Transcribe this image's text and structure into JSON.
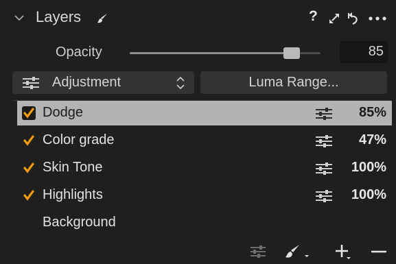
{
  "header": {
    "title": "Layers",
    "help_label": "?",
    "icons": [
      "chevron-down-icon",
      "brush-icon",
      "expand-icon",
      "reset-icon",
      "more-icon"
    ]
  },
  "opacity": {
    "label": "Opacity",
    "value": "85",
    "slider_fraction": 0.85
  },
  "mode": {
    "selected": "Adjustment",
    "luma_button": "Luma Range..."
  },
  "layers": [
    {
      "name": "Dodge",
      "opacity": "85%",
      "checked": true,
      "selected": true
    },
    {
      "name": "Color grade",
      "opacity": "47%",
      "checked": true,
      "selected": false
    },
    {
      "name": "Skin Tone",
      "opacity": "100%",
      "checked": true,
      "selected": false
    },
    {
      "name": "Highlights",
      "opacity": "100%",
      "checked": true,
      "selected": false
    },
    {
      "name": "Background",
      "opacity": "",
      "checked": false,
      "selected": false
    }
  ],
  "footer": {
    "icons": [
      "layer-settings-icon",
      "brush-add-icon",
      "add-icon",
      "remove-icon"
    ]
  },
  "colors": {
    "background": "#1f1f1f",
    "checkmark": "#f39c12",
    "selected_row": "#b3b3b3",
    "control": "#333333"
  }
}
